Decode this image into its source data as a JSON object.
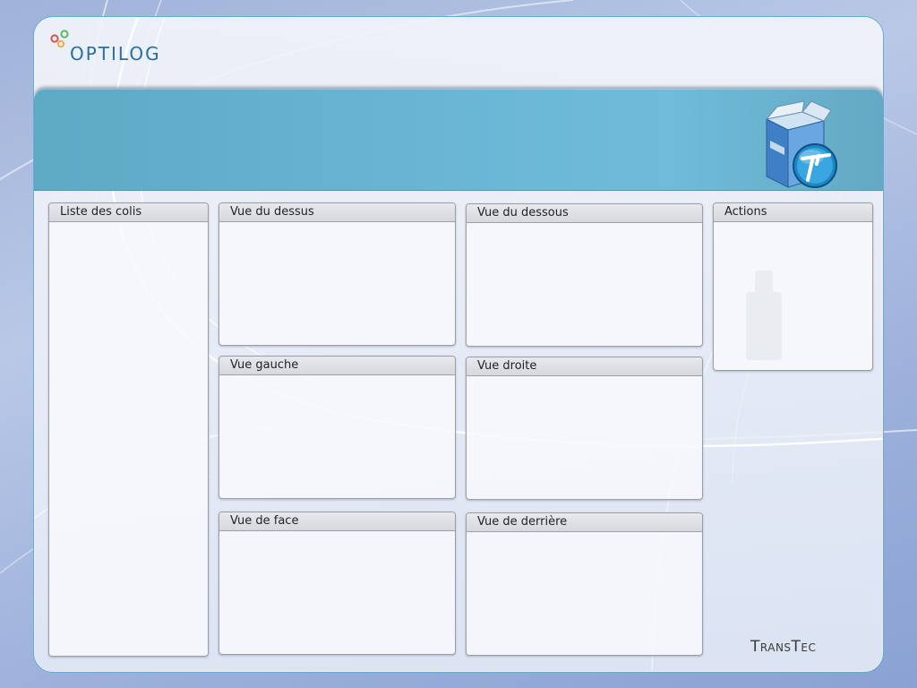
{
  "app": {
    "brand_logo_text": "OPTILOG",
    "vendor_logo_text": "TransTec"
  },
  "panels": {
    "package_list": {
      "title": "Liste des colis"
    },
    "top_view": {
      "title": "Vue du dessus"
    },
    "bottom_view": {
      "title": "Vue du dessous"
    },
    "actions": {
      "title": "Actions"
    },
    "left_view": {
      "title": "Vue gauche"
    },
    "right_view": {
      "title": "Vue droite"
    },
    "front_view": {
      "title": "Vue de face"
    },
    "back_view": {
      "title": "Vue de derrière"
    }
  },
  "icons": {
    "product": "product-box-icon",
    "logo_dots": "logo-dots-icon"
  },
  "colors": {
    "banner": "#6bb7d6",
    "accent_border": "#69a9d8",
    "logo_text": "#2b6f9e",
    "logo_highlight": "#1f9ad6"
  }
}
